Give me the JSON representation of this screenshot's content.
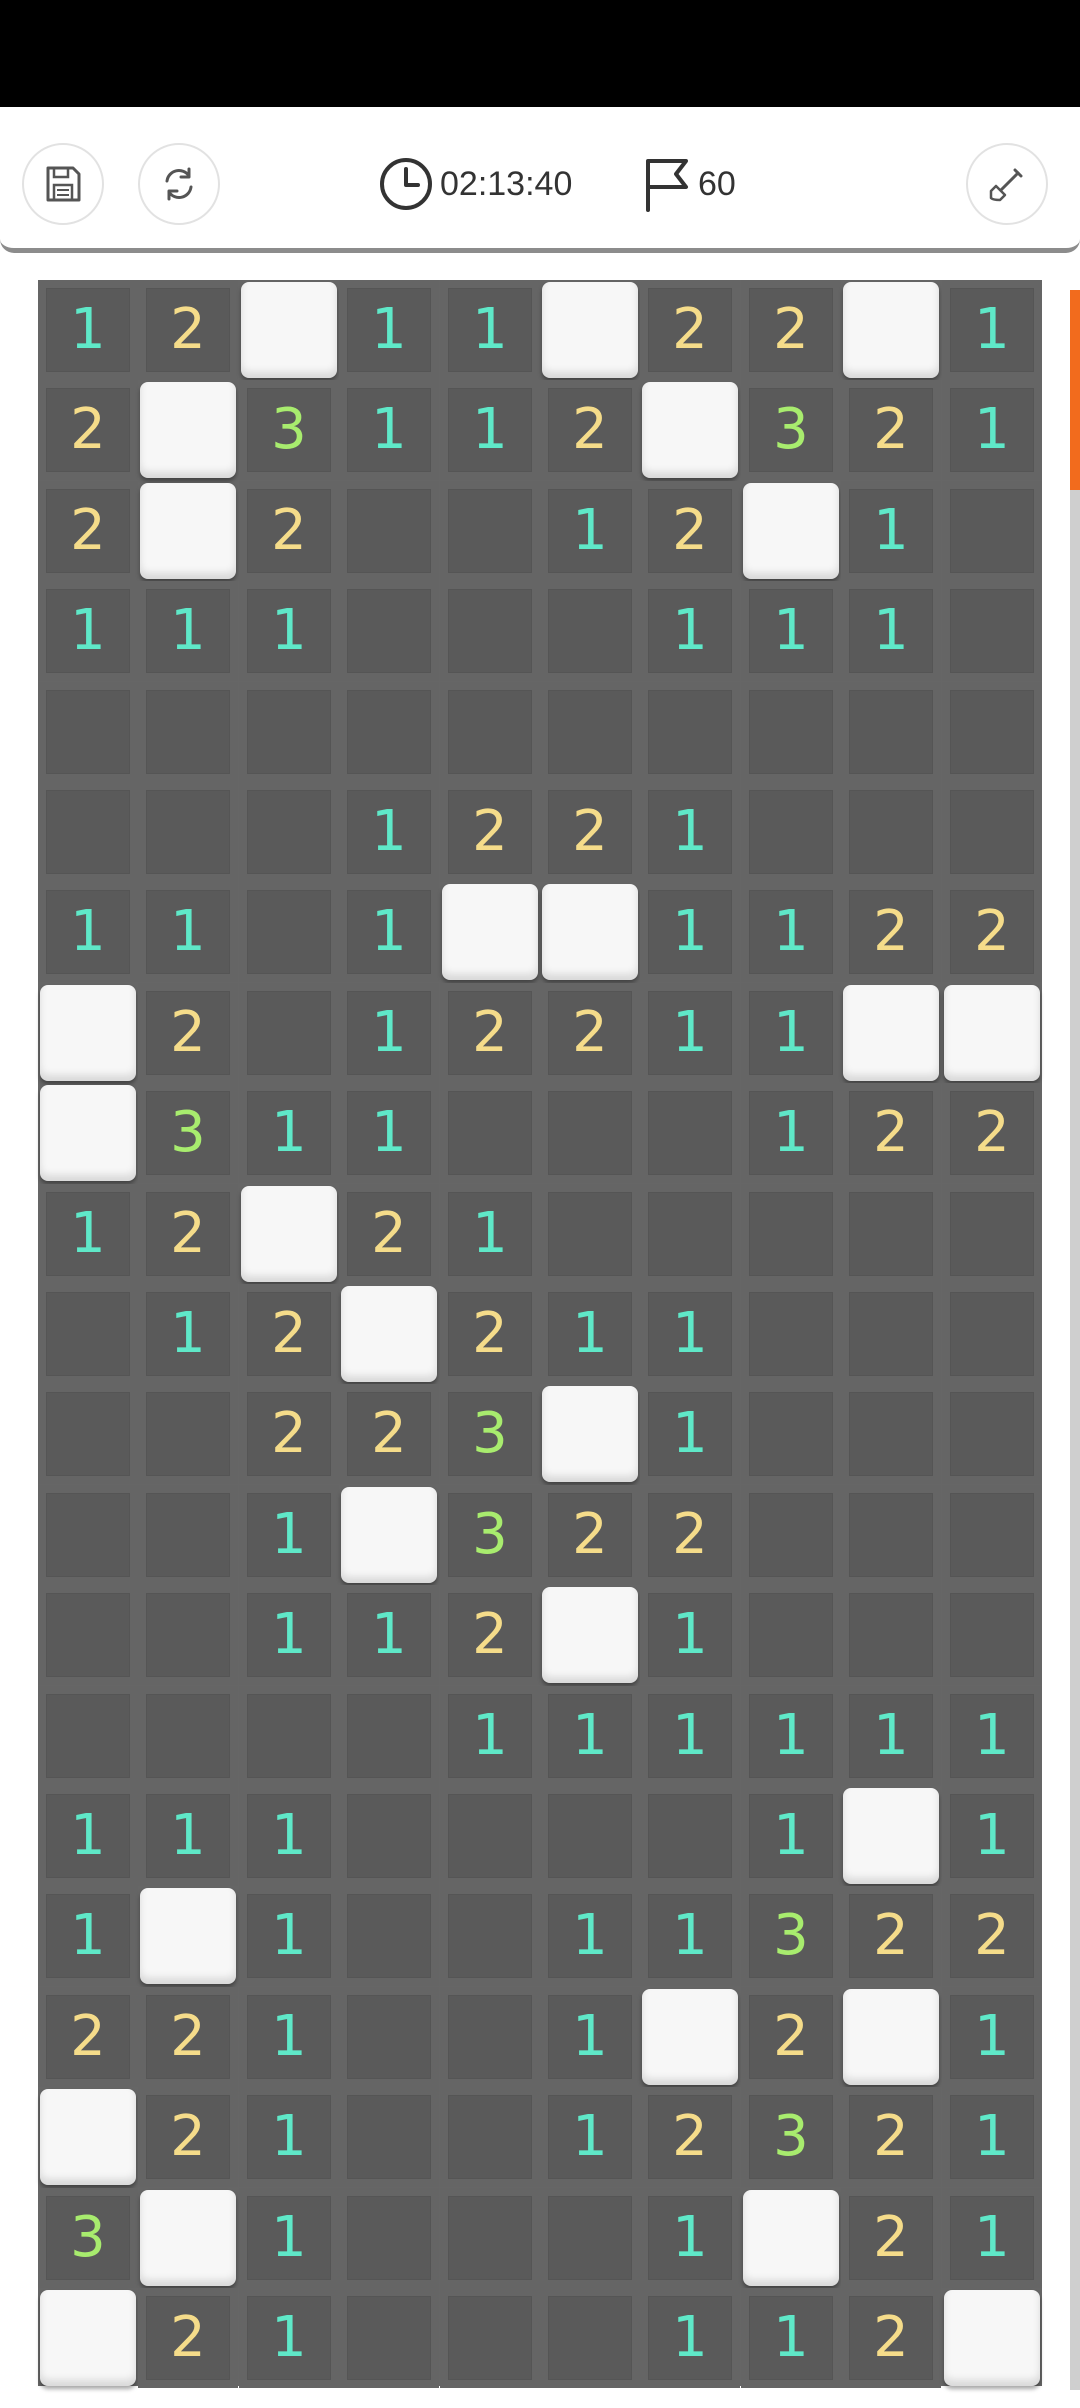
{
  "toolbar": {
    "save_icon": "floppy-disk-icon",
    "restart_icon": "refresh-icon",
    "timer_icon": "clock-icon",
    "timer": "02:13:40",
    "flag_icon": "flag-icon",
    "flags": "60",
    "dig_icon": "shovel-icon"
  },
  "colors": {
    "1": "#5fe8c8",
    "2": "#f5dc8a",
    "3": "#a8ec6e"
  },
  "board": {
    "rows": [
      [
        "1",
        "2",
        "H",
        "1",
        "1",
        "H",
        "2",
        "2",
        "H",
        "1"
      ],
      [
        "2",
        "H",
        "3",
        "1",
        "1",
        "2",
        "H",
        "3",
        "2",
        "1"
      ],
      [
        "2",
        "H",
        "2",
        "",
        "",
        "1",
        "2",
        "H",
        "1",
        ""
      ],
      [
        "1",
        "1",
        "1",
        "",
        "",
        "",
        "1",
        "1",
        "1",
        ""
      ],
      [
        "",
        "",
        "",
        "",
        "",
        "",
        "",
        "",
        "",
        ""
      ],
      [
        "",
        "",
        "",
        "1",
        "2",
        "2",
        "1",
        "",
        "",
        ""
      ],
      [
        "1",
        "1",
        "",
        "1",
        "H",
        "H",
        "1",
        "1",
        "2",
        "2"
      ],
      [
        "H",
        "2",
        "",
        "1",
        "2",
        "2",
        "1",
        "1",
        "H",
        "H"
      ],
      [
        "H",
        "3",
        "1",
        "1",
        "",
        "",
        "",
        "1",
        "2",
        "2"
      ],
      [
        "1",
        "2",
        "H",
        "2",
        "1",
        "",
        "",
        "",
        "",
        ""
      ],
      [
        "",
        "1",
        "2",
        "H",
        "2",
        "1",
        "1",
        "",
        "",
        ""
      ],
      [
        "",
        "",
        "2",
        "2",
        "3",
        "H",
        "1",
        "",
        "",
        ""
      ],
      [
        "",
        "",
        "1",
        "H",
        "3",
        "2",
        "2",
        "",
        "",
        ""
      ],
      [
        "",
        "",
        "1",
        "1",
        "2",
        "H",
        "1",
        "",
        "",
        ""
      ],
      [
        "",
        "",
        "",
        "",
        "1",
        "1",
        "1",
        "1",
        "1",
        "1"
      ],
      [
        "1",
        "1",
        "1",
        "",
        "",
        "",
        "",
        "1",
        "H",
        "1"
      ],
      [
        "1",
        "H",
        "1",
        "",
        "",
        "1",
        "1",
        "3",
        "2",
        "2"
      ],
      [
        "2",
        "2",
        "1",
        "",
        "",
        "1",
        "H",
        "2",
        "H",
        "1"
      ],
      [
        "H",
        "2",
        "1",
        "",
        "",
        "1",
        "2",
        "3",
        "2",
        "1"
      ],
      [
        "3",
        "H",
        "1",
        "",
        "",
        "",
        "1",
        "H",
        "2",
        "1"
      ],
      [
        "H",
        "2",
        "1",
        "",
        "",
        "",
        "1",
        "1",
        "2",
        "H"
      ]
    ]
  }
}
